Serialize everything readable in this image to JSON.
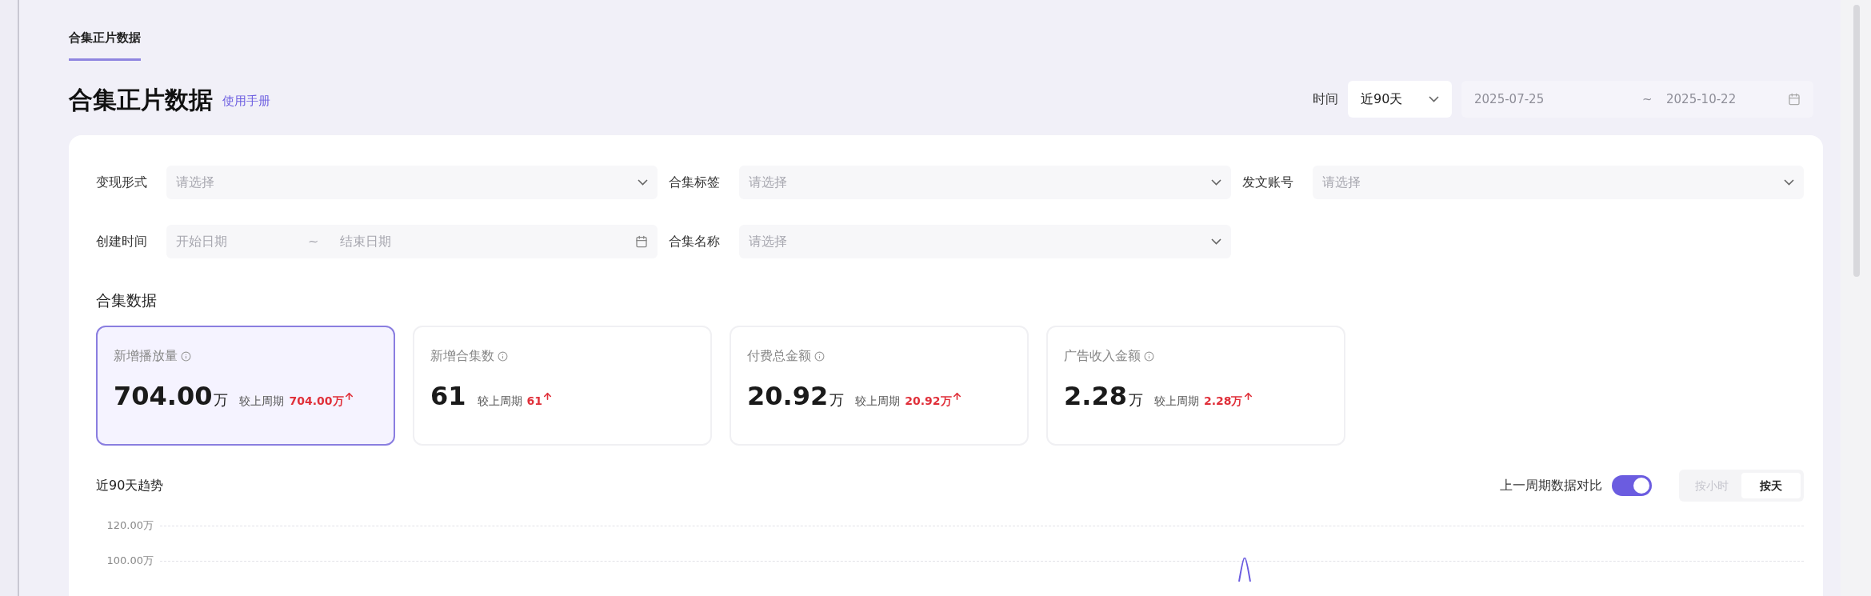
{
  "tabs": [
    {
      "label": "合集正片数据",
      "selected": true
    }
  ],
  "header": {
    "title": "合集正片数据",
    "manual_link": "使用手册",
    "time_label": "时间",
    "time_select": "近90天",
    "date_start": "2025-07-25",
    "date_separator": "~",
    "date_end": "2025-10-22"
  },
  "filters": [
    {
      "kind": "select",
      "label": "变现形式",
      "placeholder": "请选择"
    },
    {
      "kind": "select",
      "label": "合集标签",
      "placeholder": "请选择"
    },
    {
      "kind": "select",
      "label": "发文账号",
      "placeholder": "请选择"
    },
    {
      "kind": "daterange",
      "label": "创建时间",
      "start_placeholder": "开始日期",
      "separator": "~",
      "end_placeholder": "结束日期"
    },
    {
      "kind": "select",
      "label": "合集名称",
      "placeholder": "请选择"
    }
  ],
  "section_title": "合集数据",
  "metrics": [
    {
      "label": "新增播放量",
      "value": "704.00",
      "unit": "万",
      "compare_label": "较上周期",
      "compare_value": "704.00万",
      "selected": true
    },
    {
      "label": "新增合集数",
      "value": "61",
      "compare_label": "较上周期",
      "compare_value": "61",
      "selected": false
    },
    {
      "label": "付费总金额",
      "value": "20.92",
      "unit": "万",
      "compare_label": "较上周期",
      "compare_value": "20.92万",
      "selected": false
    },
    {
      "label": "广告收入金额",
      "value": "2.28",
      "unit": "万",
      "compare_label": "较上周期",
      "compare_value": "2.28万",
      "selected": false
    }
  ],
  "trend": {
    "title": "近90天趋势",
    "compare_toggle_label": "上一周期数据对比",
    "compare_on": true,
    "granularity": [
      {
        "label": "按小时",
        "selected": false
      },
      {
        "label": "按天",
        "selected": true
      }
    ],
    "y_tick_labels": [
      "120.00万",
      "100.00万"
    ]
  }
}
